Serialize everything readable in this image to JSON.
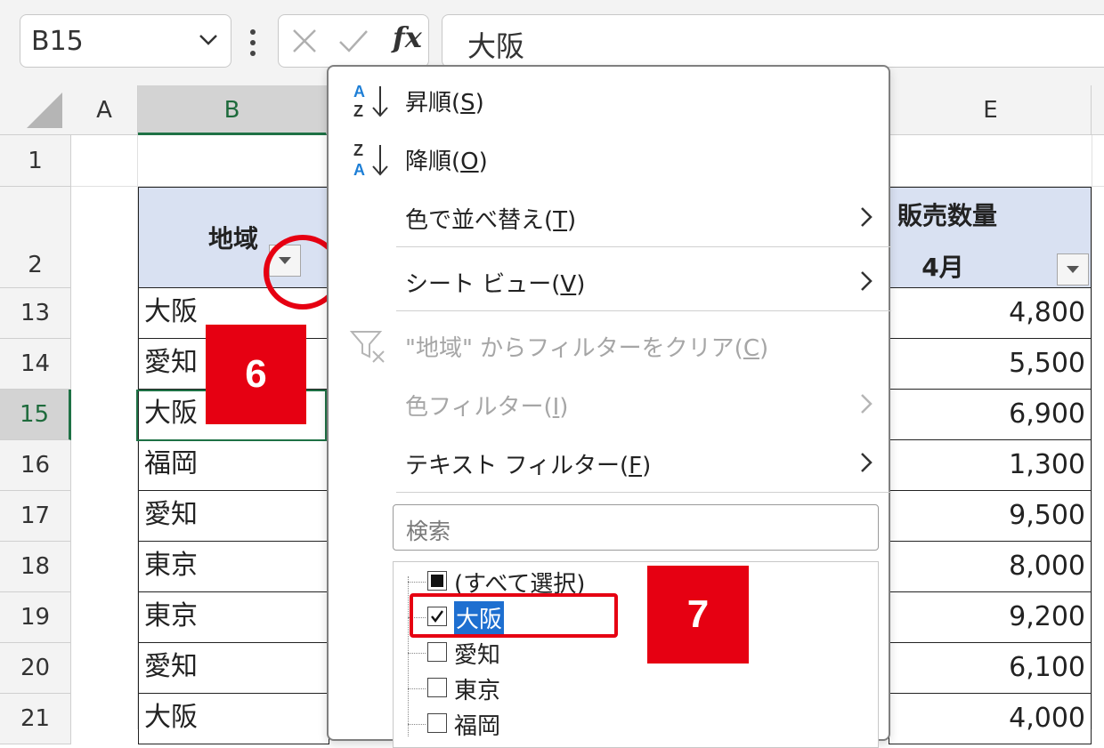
{
  "formula_bar": {
    "name_box": "B15",
    "formula_value": "大阪",
    "fx_label": "fx"
  },
  "grid": {
    "columns": [
      "A",
      "B",
      "E"
    ],
    "rows": [
      {
        "num": "1",
        "region": "",
        "qty": ""
      },
      {
        "num": "2",
        "region": "",
        "qty": ""
      },
      {
        "num": "13",
        "region": "大阪",
        "qty": "4,800"
      },
      {
        "num": "14",
        "region": "愛知",
        "qty": "5,500"
      },
      {
        "num": "15",
        "region": "大阪",
        "qty": "6,900"
      },
      {
        "num": "16",
        "region": "福岡",
        "qty": "1,300"
      },
      {
        "num": "17",
        "region": "愛知",
        "qty": "9,500"
      },
      {
        "num": "18",
        "region": "東京",
        "qty": "8,000"
      },
      {
        "num": "19",
        "region": "東京",
        "qty": "9,200"
      },
      {
        "num": "20",
        "region": "愛知",
        "qty": "6,100"
      },
      {
        "num": "21",
        "region": "大阪",
        "qty": "4,000"
      }
    ],
    "header_region": "地域",
    "header_qty_line1": "販売数量",
    "header_qty_line2": "4月"
  },
  "menu": {
    "sort_asc": "昇順(",
    "sort_asc_key": "S",
    "sort_desc": "降順(",
    "sort_desc_key": "O",
    "sort_color": "色で並べ替え(",
    "sort_color_key": "T",
    "sheet_view": "シート ビュー(",
    "sheet_view_key": "V",
    "clear_filter": "\"地域\" からフィルターをクリア(",
    "clear_filter_key": "C",
    "color_filter": "色フィルター(",
    "color_filter_key": "I",
    "text_filter": "テキスト フィルター(",
    "text_filter_key": "F",
    "close_paren": ")",
    "search_placeholder": "検索",
    "list": [
      {
        "label": "(すべて選択)",
        "state": "partial"
      },
      {
        "label": "大阪",
        "state": "checked"
      },
      {
        "label": "愛知",
        "state": "unchecked"
      },
      {
        "label": "東京",
        "state": "unchecked"
      },
      {
        "label": "福岡",
        "state": "unchecked"
      }
    ]
  },
  "annotations": {
    "step6": "6",
    "step7": "7"
  },
  "colors": {
    "accent_green": "#1e7145",
    "header_fill": "#d9e1f2",
    "annotation_red": "#e60012",
    "selection_blue": "#1e6fd0"
  }
}
